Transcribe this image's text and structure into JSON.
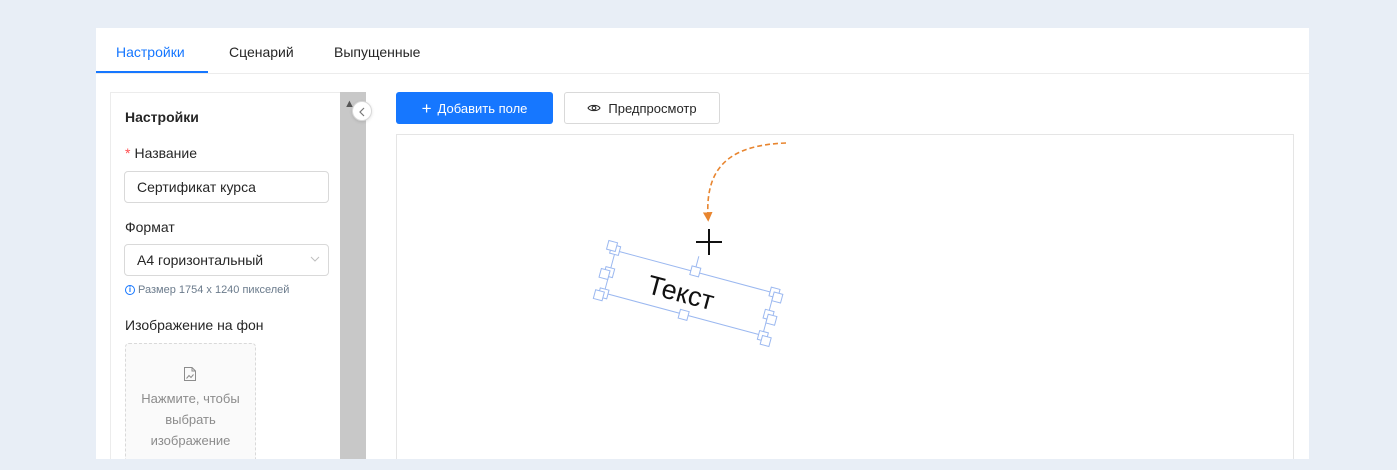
{
  "tabs": [
    {
      "label": "Настройки",
      "active": true
    },
    {
      "label": "Сценарий",
      "active": false
    },
    {
      "label": "Выпущенные",
      "active": false
    }
  ],
  "settings": {
    "title": "Настройки",
    "name_label": "Название",
    "name_required_mark": "*",
    "name_value": "Сертификат курса",
    "format_label": "Формат",
    "format_value": "A4 горизонтальный",
    "size_hint": "Размер 1754 x 1240 пикселей",
    "bg_image_label": "Изображение на фон",
    "upload_text": "Нажмите, чтобы выбрать изображение"
  },
  "toolbar": {
    "add_field_label": "Добавить поле",
    "preview_label": "Предпросмотр"
  },
  "canvas": {
    "text_field_value": "Текст",
    "rotation_degrees": 15
  },
  "colors": {
    "accent": "#1677ff",
    "required": "#ff4d4f",
    "annotation_arrow": "#e8852f",
    "selection_handle": "#9bb8f0"
  },
  "icons": {
    "add": "plus-icon",
    "preview": "eye-icon",
    "collapse": "chevron-left-icon",
    "select": "chevron-down-icon",
    "hint": "info-icon",
    "upload": "image-file-icon",
    "move": "move-cursor-icon"
  }
}
